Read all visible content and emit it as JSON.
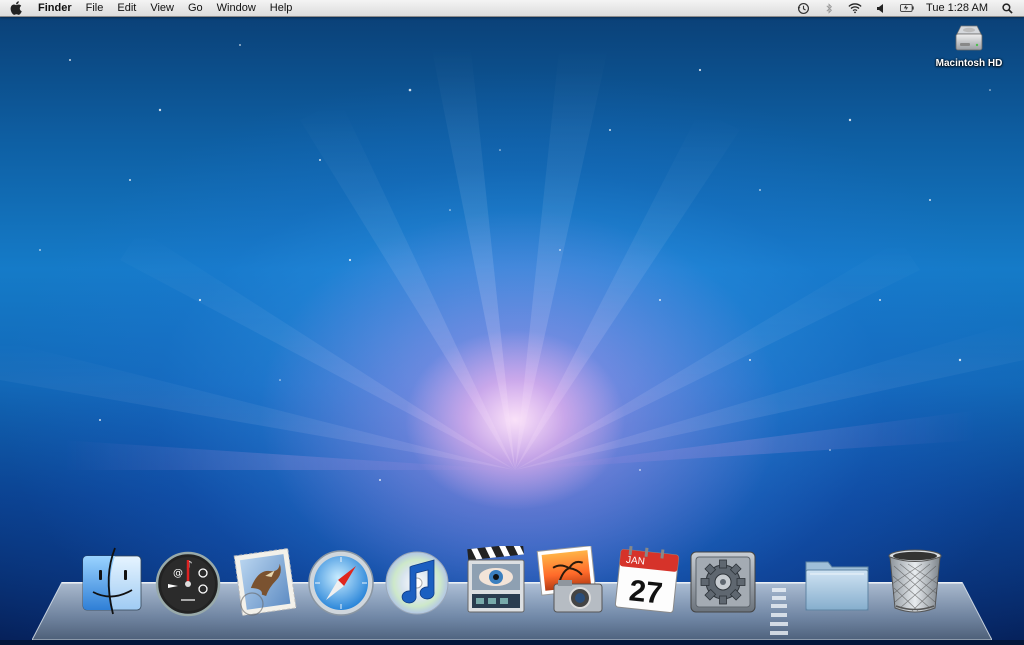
{
  "menubar": {
    "app_name": "Finder",
    "menus": [
      "File",
      "Edit",
      "View",
      "Go",
      "Window",
      "Help"
    ],
    "clock": "Tue 1:28 AM"
  },
  "desktop": {
    "drive_label": "Macintosh HD"
  },
  "dock": {
    "items": [
      {
        "name": "finder",
        "label": ""
      },
      {
        "name": "dashboard",
        "label": ""
      },
      {
        "name": "mail",
        "label": ""
      },
      {
        "name": "safari",
        "label": ""
      },
      {
        "name": "itunes",
        "label": ""
      },
      {
        "name": "front-row",
        "label": ""
      },
      {
        "name": "iphoto",
        "label": ""
      },
      {
        "name": "ical",
        "label": ""
      },
      {
        "name": "system-preferences",
        "label": ""
      },
      {
        "name": "downloads-folder",
        "label": ""
      },
      {
        "name": "trash",
        "label": ""
      }
    ],
    "ical_month": "JAN",
    "ical_day": "27"
  },
  "colors": {
    "menubar_top": "#f4f4f4",
    "menubar_bottom": "#dcdcdc",
    "wallpaper_glow": "#ffb8f0",
    "wallpaper_blue": "#157bc8"
  }
}
